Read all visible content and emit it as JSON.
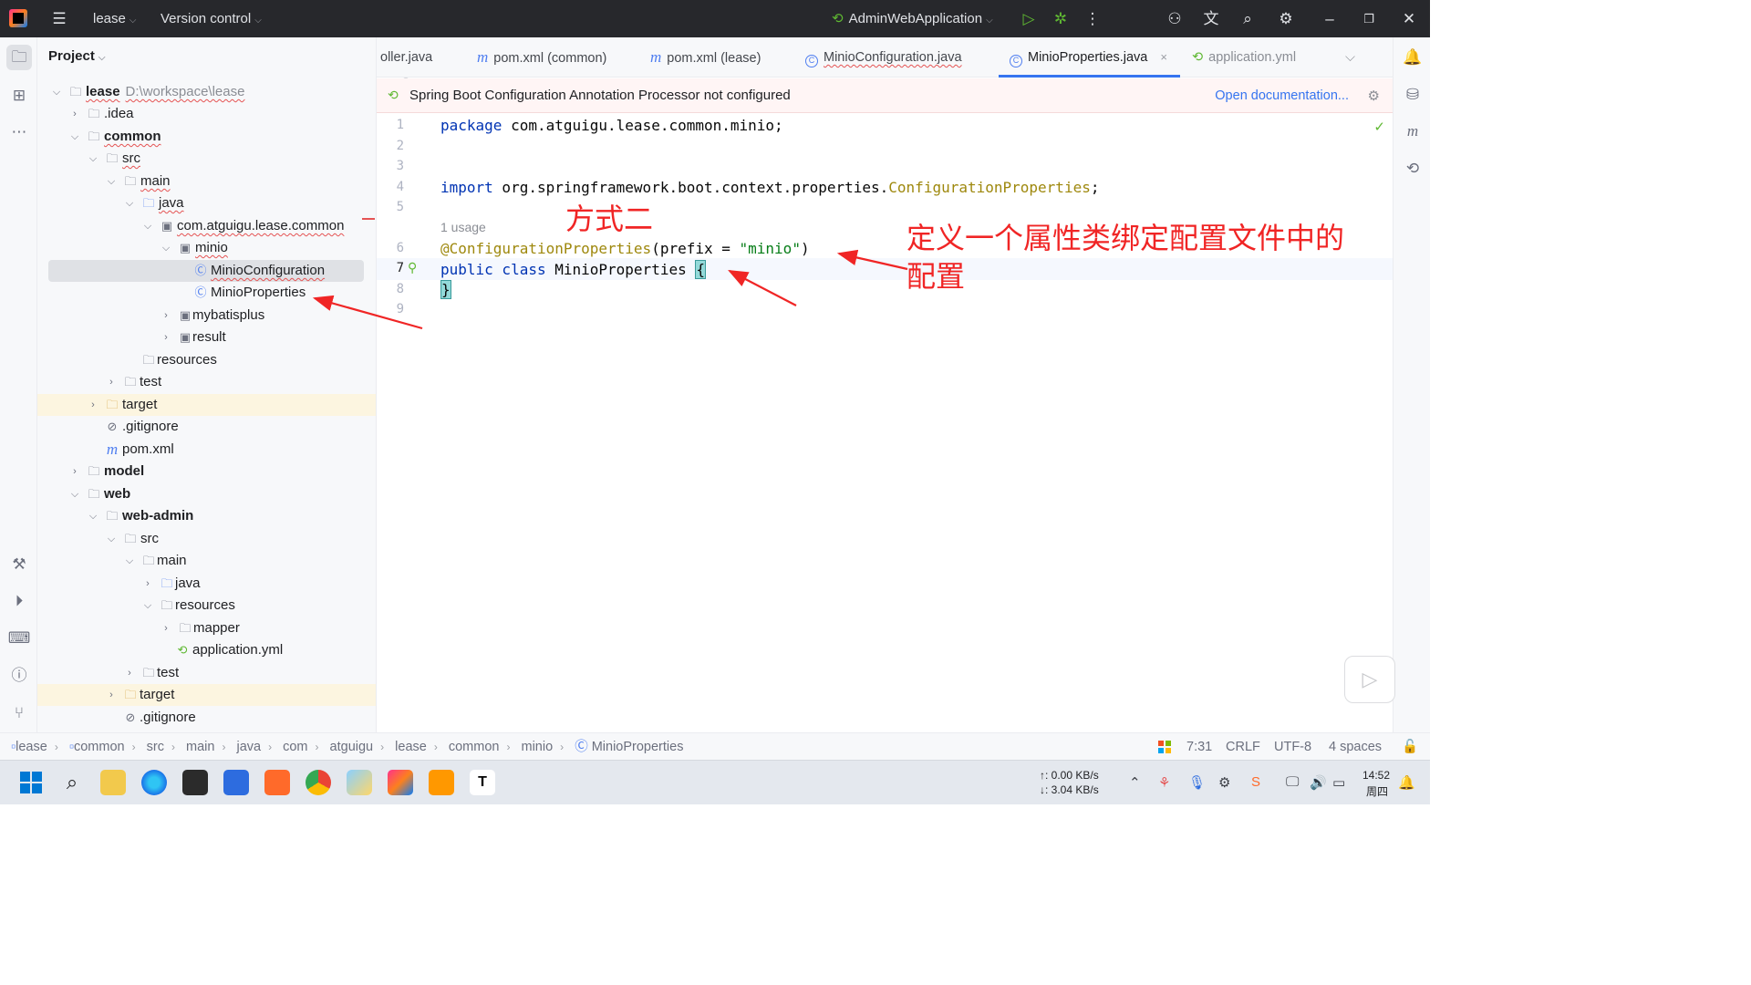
{
  "titlebar": {
    "project": "lease",
    "vcs": "Version control",
    "run_config": "AdminWebApplication"
  },
  "project_panel": {
    "title": "Project",
    "tree": [
      {
        "label": "lease",
        "path": "D:\\workspace\\lease",
        "bold": true
      },
      {
        "label": ".idea"
      },
      {
        "label": "common",
        "bold": true
      },
      {
        "label": "src"
      },
      {
        "label": "main"
      },
      {
        "label": "java"
      },
      {
        "label": "com.atguigu.lease.common"
      },
      {
        "label": "minio"
      },
      {
        "label": "MinioConfiguration"
      },
      {
        "label": "MinioProperties"
      },
      {
        "label": "mybatisplus"
      },
      {
        "label": "result"
      },
      {
        "label": "resources"
      },
      {
        "label": "test"
      },
      {
        "label": "target"
      },
      {
        "label": ".gitignore"
      },
      {
        "label": "pom.xml"
      },
      {
        "label": "model",
        "bold": true
      },
      {
        "label": "web",
        "bold": true
      },
      {
        "label": "web-admin",
        "bold": true
      },
      {
        "label": "src"
      },
      {
        "label": "main"
      },
      {
        "label": "java"
      },
      {
        "label": "resources"
      },
      {
        "label": "mapper"
      },
      {
        "label": "application.yml"
      },
      {
        "label": "test"
      },
      {
        "label": "target"
      },
      {
        "label": ".gitignore"
      }
    ]
  },
  "tabs": [
    {
      "label": "oller.java"
    },
    {
      "label": "pom.xml (common)"
    },
    {
      "label": "pom.xml (lease)"
    },
    {
      "label": "MinioConfiguration.java"
    },
    {
      "label": "MinioProperties.java",
      "active": true
    },
    {
      "label": "application.yml"
    }
  ],
  "banner": {
    "message": "Spring Boot Configuration Annotation Processor not configured",
    "link": "Open documentation..."
  },
  "editor": {
    "line_numbers": [
      "1",
      "2",
      "3",
      "4",
      "5",
      "6",
      "7",
      "8",
      "9"
    ],
    "line1_kw": "package",
    "line1_rest": " com.atguigu.lease.common.minio;",
    "line4_kw": "import",
    "line4_pkg": " org.springframework.boot.context.properties.",
    "line4_class": "ConfigurationProperties",
    "line4_end": ";",
    "usage_hint": "1 usage",
    "line6_ann": "@ConfigurationProperties",
    "line6_open": "(prefix = ",
    "line6_str": "\"minio\"",
    "line6_close": ")",
    "line7_kw": "public class",
    "line7_name": " MinioProperties ",
    "line7_brace": "{",
    "line8_brace": "}"
  },
  "annotations": {
    "method_label": "方式二",
    "explain_line1": "定义一个属性类绑定配置文件中的",
    "explain_line2": "配置"
  },
  "breadcrumb": [
    "lease",
    "common",
    "src",
    "main",
    "java",
    "com",
    "atguigu",
    "lease",
    "common",
    "minio",
    "MinioProperties"
  ],
  "status": {
    "position": "7:31",
    "line_sep": "CRLF",
    "encoding": "UTF-8",
    "indent": "4 spaces"
  },
  "taskbar": {
    "net_up": "↑: 0.00 KB/s",
    "net_down": "↓: 3.04 KB/s",
    "time": "14:52",
    "day": "周四"
  },
  "colors": {
    "keyword": "#0033b3",
    "annotation": "#9e880d",
    "string": "#067d17",
    "accent": "#3574f0",
    "note_red": "#f02525"
  }
}
